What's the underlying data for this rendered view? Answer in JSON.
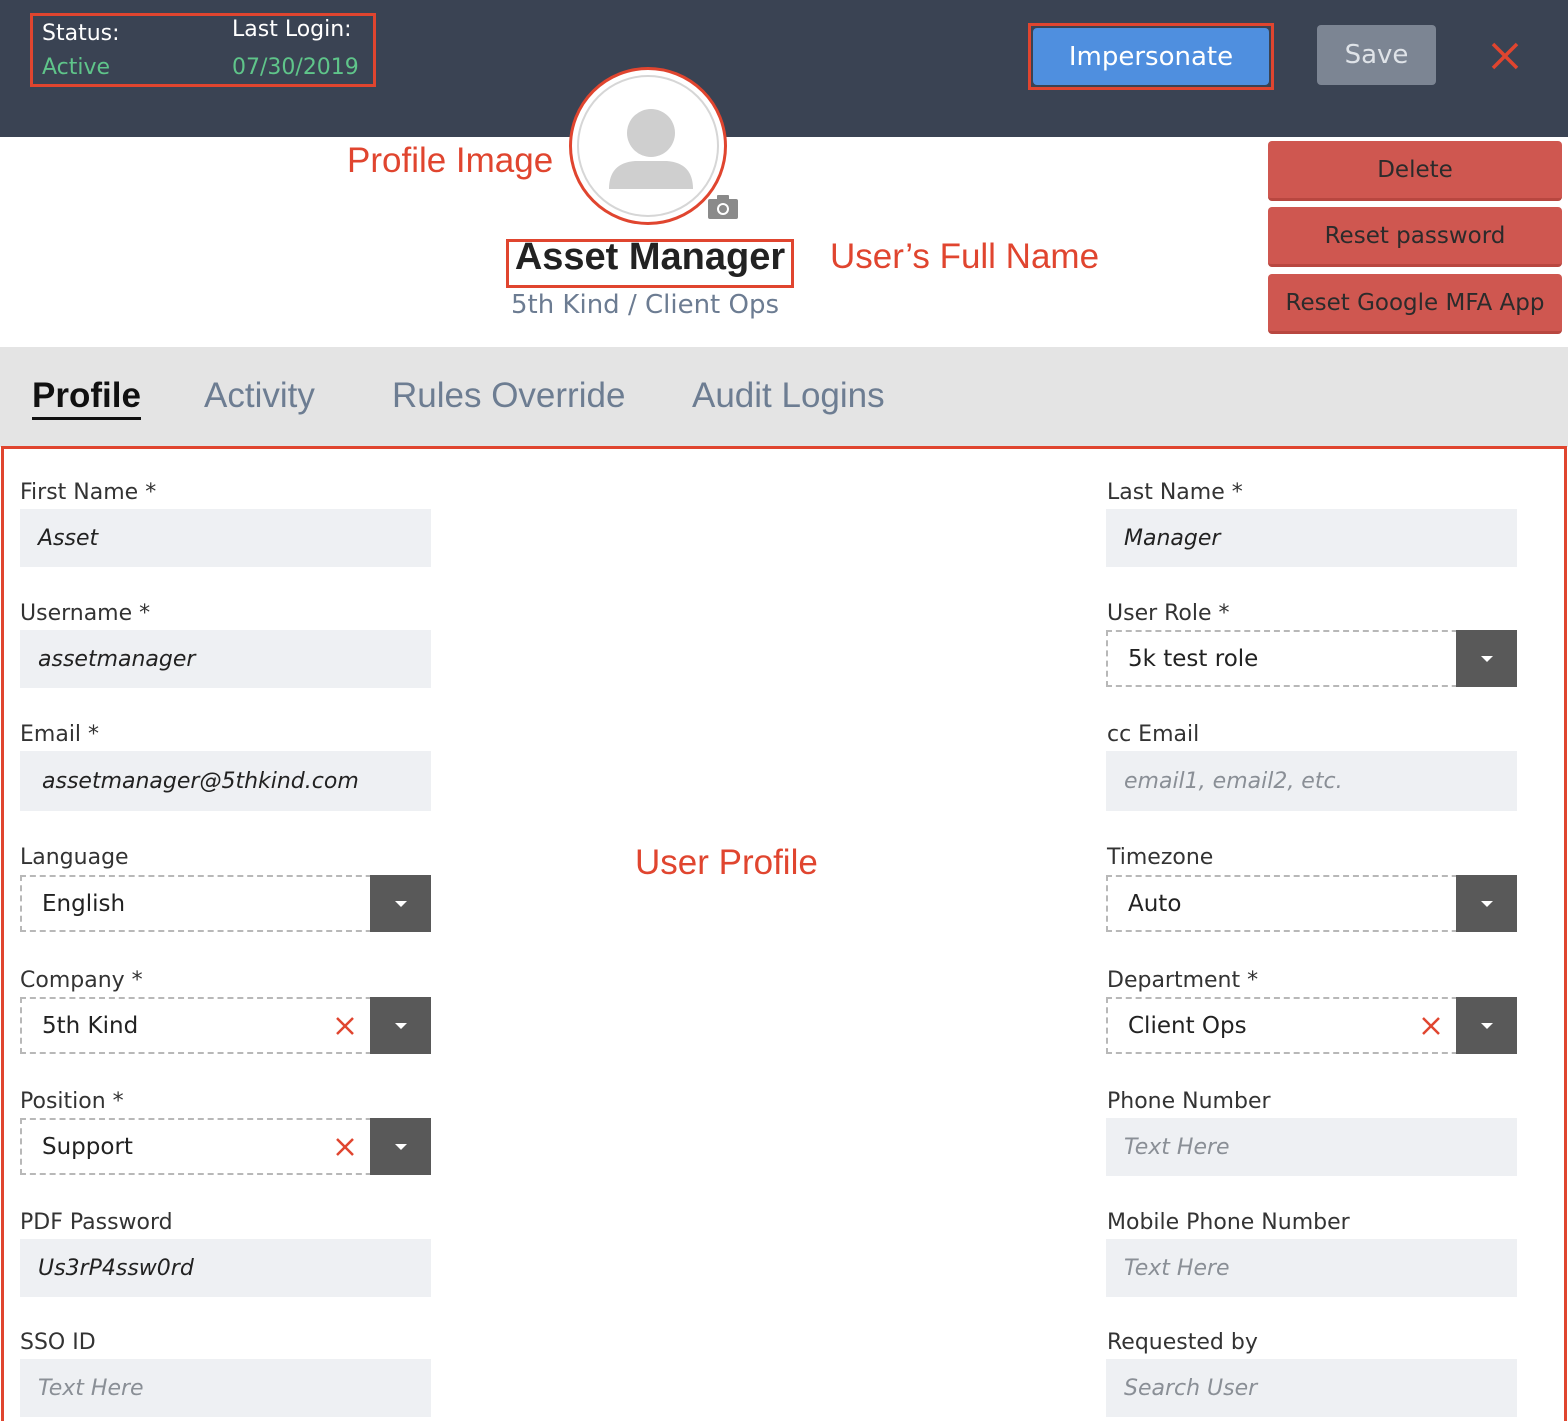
{
  "header": {
    "status_label": "Status:",
    "status_value": "Active",
    "last_login_label": "Last Login:",
    "last_login_value": "07/30/2019",
    "impersonate_label": "Impersonate",
    "save_label": "Save",
    "close_icon": "close-icon"
  },
  "annotations": {
    "profile_image": "Profile Image",
    "full_name": "User’s Full Name",
    "user_profile": "User Profile"
  },
  "profile": {
    "full_name": "Asset Manager",
    "subline": "5th Kind / Client Ops",
    "avatar_icon": "user-avatar-icon",
    "camera_icon": "camera-icon"
  },
  "actions": {
    "delete_label": "Delete",
    "reset_password_label": "Reset password",
    "reset_mfa_label": "Reset Google MFA App"
  },
  "tabs": [
    {
      "label": "Profile",
      "active": true
    },
    {
      "label": "Activity",
      "active": false
    },
    {
      "label": "Rules Override",
      "active": false
    },
    {
      "label": "Audit Logins",
      "active": false
    }
  ],
  "form": {
    "first_name": {
      "label": "First Name *",
      "value": "Asset"
    },
    "last_name": {
      "label": "Last Name *",
      "value": "Manager"
    },
    "username": {
      "label": "Username *",
      "value": "assetmanager"
    },
    "user_role": {
      "label": "User Role *",
      "value": "5k test role"
    },
    "email": {
      "label": "Email *",
      "value": "assetmanager@5thkind.com"
    },
    "cc_email": {
      "label": "cc Email",
      "placeholder": "email1, email2, etc."
    },
    "language": {
      "label": "Language",
      "value": "English"
    },
    "timezone": {
      "label": "Timezone",
      "value": "Auto"
    },
    "company": {
      "label": "Company *",
      "value": "5th Kind"
    },
    "department": {
      "label": "Department *",
      "value": "Client Ops"
    },
    "position": {
      "label": "Position *",
      "value": "Support"
    },
    "phone": {
      "label": "Phone Number",
      "placeholder": "Text Here"
    },
    "pdf_password": {
      "label": "PDF Password",
      "value": "Us3rP4ssw0rd"
    },
    "mobile_phone": {
      "label": "Mobile Phone Number",
      "placeholder": "Text Here"
    },
    "sso_id": {
      "label": "SSO ID",
      "placeholder": "Text Here"
    },
    "requested_by": {
      "label": "Requested by",
      "placeholder": "Search User"
    }
  },
  "colors": {
    "header_bg": "#3a4353",
    "status_green": "#5fc58a",
    "primary_blue": "#4f8fdf",
    "danger_red": "#cf5750",
    "annotation_red": "#e0452f"
  }
}
